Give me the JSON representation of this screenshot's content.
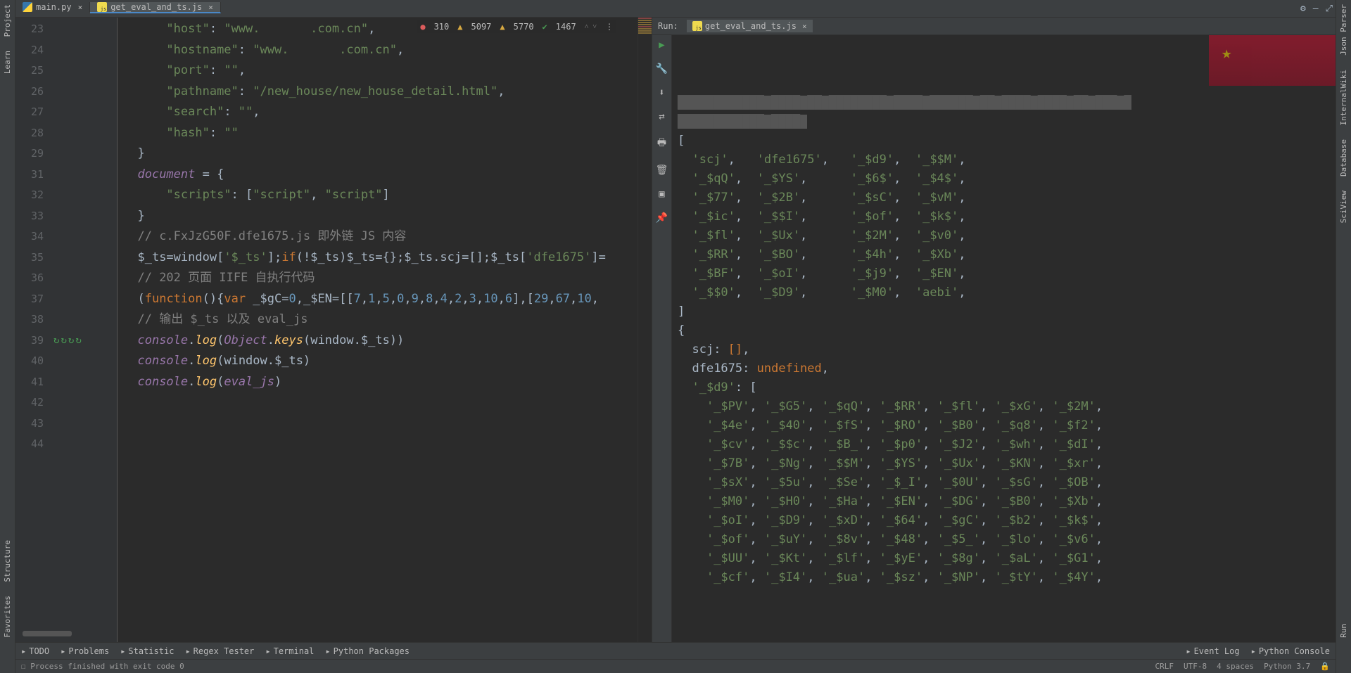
{
  "tabs": [
    {
      "icon": "py",
      "label": "main.py",
      "active": false
    },
    {
      "icon": "js",
      "label": "get_eval_and_ts.js",
      "active": true
    }
  ],
  "left_rail": [
    "Project",
    "Learn",
    "Structure",
    "Favorites"
  ],
  "right_rail": [
    "Json Parser",
    "InternalWiki",
    "Database",
    "SciView",
    "Run"
  ],
  "analysis": {
    "errors": "310",
    "warn1": "5097",
    "warn2": "5770",
    "ok": "1467"
  },
  "gutter_numbers": [
    "23",
    "24",
    "25",
    "26",
    "27",
    "28",
    "29",
    "",
    "31",
    "32",
    "33",
    "34",
    "35",
    "36",
    "37",
    "38",
    "39",
    "40",
    "41",
    "42",
    "43",
    "44"
  ],
  "code_lines": [
    {
      "indent": 6,
      "tokens": [
        {
          "t": "str",
          "v": "\"host\""
        },
        {
          "t": "pl",
          "v": ": "
        },
        {
          "t": "str",
          "v": "\"www."
        },
        {
          "t": "redact",
          "v": "       "
        },
        {
          "t": "str",
          "v": ".com.cn\""
        },
        {
          "t": "pl",
          "v": ","
        }
      ]
    },
    {
      "indent": 6,
      "tokens": [
        {
          "t": "str",
          "v": "\"hostname\""
        },
        {
          "t": "pl",
          "v": ": "
        },
        {
          "t": "str",
          "v": "\"www."
        },
        {
          "t": "redact",
          "v": "       "
        },
        {
          "t": "str",
          "v": ".com.cn\""
        },
        {
          "t": "pl",
          "v": ","
        }
      ]
    },
    {
      "indent": 6,
      "tokens": [
        {
          "t": "str",
          "v": "\"port\""
        },
        {
          "t": "pl",
          "v": ": "
        },
        {
          "t": "str",
          "v": "\"\""
        },
        {
          "t": "pl",
          "v": ","
        }
      ]
    },
    {
      "indent": 6,
      "tokens": [
        {
          "t": "str",
          "v": "\"pathname\""
        },
        {
          "t": "pl",
          "v": ": "
        },
        {
          "t": "str",
          "v": "\"/new_house/new_house_detail.html\""
        },
        {
          "t": "pl",
          "v": ","
        }
      ]
    },
    {
      "indent": 6,
      "tokens": [
        {
          "t": "str",
          "v": "\"search\""
        },
        {
          "t": "pl",
          "v": ": "
        },
        {
          "t": "str",
          "v": "\"\""
        },
        {
          "t": "pl",
          "v": ","
        }
      ]
    },
    {
      "indent": 6,
      "tokens": [
        {
          "t": "str",
          "v": "\"hash\""
        },
        {
          "t": "pl",
          "v": ": "
        },
        {
          "t": "str",
          "v": "\"\""
        }
      ]
    },
    {
      "indent": 2,
      "tokens": [
        {
          "t": "pl",
          "v": "}"
        }
      ]
    },
    {
      "indent": 0,
      "tokens": []
    },
    {
      "indent": 2,
      "tokens": [
        {
          "t": "id",
          "v": "document"
        },
        {
          "t": "pl",
          "v": " = {"
        }
      ]
    },
    {
      "indent": 6,
      "tokens": [
        {
          "t": "str",
          "v": "\"scripts\""
        },
        {
          "t": "pl",
          "v": ": ["
        },
        {
          "t": "str",
          "v": "\"script\""
        },
        {
          "t": "pl",
          "v": ", "
        },
        {
          "t": "str",
          "v": "\"script\""
        },
        {
          "t": "pl",
          "v": "]"
        }
      ]
    },
    {
      "indent": 2,
      "tokens": [
        {
          "t": "pl",
          "v": "}"
        }
      ]
    },
    {
      "indent": 0,
      "tokens": []
    },
    {
      "indent": 2,
      "tokens": [
        {
          "t": "cm",
          "v": "// c.FxJzG50F.dfe1675.js 即外链 JS 内容"
        }
      ]
    },
    {
      "indent": 2,
      "tokens": [
        {
          "t": "pl",
          "v": "$_ts=window["
        },
        {
          "t": "str",
          "v": "'$_ts'"
        },
        {
          "t": "pl",
          "v": "];"
        },
        {
          "t": "kw",
          "v": "if"
        },
        {
          "t": "pl",
          "v": "(!$_ts)$_ts={};$_ts.scj=[];$_ts["
        },
        {
          "t": "str",
          "v": "'dfe1675'"
        },
        {
          "t": "pl",
          "v": "]="
        }
      ]
    },
    {
      "indent": 2,
      "tokens": [
        {
          "t": "cm",
          "v": "// 202 页面 IIFE 自执行代码"
        }
      ]
    },
    {
      "indent": 2,
      "tokens": [
        {
          "t": "pl",
          "v": "("
        },
        {
          "t": "kw",
          "v": "function"
        },
        {
          "t": "pl",
          "v": "(){"
        },
        {
          "t": "kw",
          "v": "var"
        },
        {
          "t": "pl",
          "v": " _$gC="
        },
        {
          "t": "num",
          "v": "0"
        },
        {
          "t": "pl",
          "v": ",_$EN=[["
        },
        {
          "t": "num",
          "v": "7"
        },
        {
          "t": "pl",
          "v": ","
        },
        {
          "t": "num",
          "v": "1"
        },
        {
          "t": "pl",
          "v": ","
        },
        {
          "t": "num",
          "v": "5"
        },
        {
          "t": "pl",
          "v": ","
        },
        {
          "t": "num",
          "v": "0"
        },
        {
          "t": "pl",
          "v": ","
        },
        {
          "t": "num",
          "v": "9"
        },
        {
          "t": "pl",
          "v": ","
        },
        {
          "t": "num",
          "v": "8"
        },
        {
          "t": "pl",
          "v": ","
        },
        {
          "t": "num",
          "v": "4"
        },
        {
          "t": "pl",
          "v": ","
        },
        {
          "t": "num",
          "v": "2"
        },
        {
          "t": "pl",
          "v": ","
        },
        {
          "t": "num",
          "v": "3"
        },
        {
          "t": "pl",
          "v": ","
        },
        {
          "t": "num",
          "v": "10"
        },
        {
          "t": "pl",
          "v": ","
        },
        {
          "t": "num",
          "v": "6"
        },
        {
          "t": "pl",
          "v": "],["
        },
        {
          "t": "num",
          "v": "29"
        },
        {
          "t": "pl",
          "v": ","
        },
        {
          "t": "num",
          "v": "67"
        },
        {
          "t": "pl",
          "v": ","
        },
        {
          "t": "num",
          "v": "10"
        },
        {
          "t": "pl",
          "v": ","
        }
      ]
    },
    {
      "indent": 0,
      "tokens": []
    },
    {
      "indent": 2,
      "tokens": [
        {
          "t": "cm",
          "v": "// 输出 $_ts 以及 eval_js"
        }
      ]
    },
    {
      "indent": 2,
      "tokens": [
        {
          "t": "id",
          "v": "console"
        },
        {
          "t": "pl",
          "v": "."
        },
        {
          "t": "fn",
          "v": "log"
        },
        {
          "t": "pl",
          "v": "("
        },
        {
          "t": "id",
          "v": "Object"
        },
        {
          "t": "pl",
          "v": "."
        },
        {
          "t": "fn",
          "v": "keys"
        },
        {
          "t": "pl",
          "v": "(window.$_ts))"
        }
      ]
    },
    {
      "indent": 2,
      "tokens": [
        {
          "t": "id",
          "v": "console"
        },
        {
          "t": "pl",
          "v": "."
        },
        {
          "t": "fn",
          "v": "log"
        },
        {
          "t": "pl",
          "v": "(window.$_ts)"
        }
      ]
    },
    {
      "indent": 2,
      "tokens": [
        {
          "t": "id",
          "v": "console"
        },
        {
          "t": "pl",
          "v": "."
        },
        {
          "t": "fn",
          "v": "log"
        },
        {
          "t": "pl",
          "v": "("
        },
        {
          "t": "id",
          "v": "eval_js"
        },
        {
          "t": "pl",
          "v": ")"
        }
      ]
    },
    {
      "indent": 0,
      "tokens": []
    }
  ],
  "run": {
    "label": "Run:",
    "tab_label": "get_eval_and_ts.js",
    "output_rows": [
      {
        "type": "br",
        "v": "["
      },
      {
        "type": "arr",
        "v": [
          "'scj'",
          "'dfe1675'",
          "'_$d9'",
          "'_$$M'"
        ]
      },
      {
        "type": "arr",
        "v": [
          "'_$qQ'",
          "'_$YS'",
          "'_$6$'",
          "'_$4$'"
        ]
      },
      {
        "type": "arr",
        "v": [
          "'_$77'",
          "'_$2B'",
          "'_$sC'",
          "'_$vM'"
        ]
      },
      {
        "type": "arr",
        "v": [
          "'_$ic'",
          "'_$$I'",
          "'_$of'",
          "'_$k$'"
        ]
      },
      {
        "type": "arr",
        "v": [
          "'_$fl'",
          "'_$Ux'",
          "'_$2M'",
          "'_$v0'"
        ]
      },
      {
        "type": "arr",
        "v": [
          "'_$RR'",
          "'_$BO'",
          "'_$4h'",
          "'_$Xb'"
        ]
      },
      {
        "type": "arr",
        "v": [
          "'_$BF'",
          "'_$oI'",
          "'_$j9'",
          "'_$EN'"
        ]
      },
      {
        "type": "arr",
        "v": [
          "'_$$0'",
          "'_$D9'",
          "'_$M0'",
          "'aebi'"
        ]
      },
      {
        "type": "br",
        "v": "]"
      },
      {
        "type": "br",
        "v": "{"
      },
      {
        "type": "kv",
        "k": "scj",
        "v": "[]"
      },
      {
        "type": "kv",
        "k": "dfe1675",
        "v": "undefined"
      },
      {
        "type": "kvs",
        "k": "'_$d9'",
        "v": "["
      },
      {
        "type": "arr7",
        "v": [
          "'_$PV'",
          "'_$G5'",
          "'_$qQ'",
          "'_$RR'",
          "'_$fl'",
          "'_$xG'",
          "'_$2M'"
        ]
      },
      {
        "type": "arr7",
        "v": [
          "'_$4e'",
          "'_$40'",
          "'_$fS'",
          "'_$RO'",
          "'_$B0'",
          "'_$q8'",
          "'_$f2'"
        ]
      },
      {
        "type": "arr7",
        "v": [
          "'_$cv'",
          "'_$$c'",
          "'_$B_'",
          "'_$p0'",
          "'_$J2'",
          "'_$wh'",
          "'_$dI'"
        ]
      },
      {
        "type": "arr7",
        "v": [
          "'_$7B'",
          "'_$Ng'",
          "'_$$M'",
          "'_$YS'",
          "'_$Ux'",
          "'_$KN'",
          "'_$xr'"
        ]
      },
      {
        "type": "arr7",
        "v": [
          "'_$sX'",
          "'_$5u'",
          "'_$Se'",
          "'_$_I'",
          "'_$0U'",
          "'_$sG'",
          "'_$OB'"
        ]
      },
      {
        "type": "arr7",
        "v": [
          "'_$M0'",
          "'_$H0'",
          "'_$Ha'",
          "'_$EN'",
          "'_$DG'",
          "'_$B0'",
          "'_$Xb'"
        ]
      },
      {
        "type": "arr7",
        "v": [
          "'_$oI'",
          "'_$D9'",
          "'_$xD'",
          "'_$64'",
          "'_$gC'",
          "'_$b2'",
          "'_$k$'"
        ]
      },
      {
        "type": "arr7",
        "v": [
          "'_$of'",
          "'_$uY'",
          "'_$8v'",
          "'_$48'",
          "'_$5_'",
          "'_$lo'",
          "'_$v6'"
        ]
      },
      {
        "type": "arr7",
        "v": [
          "'_$UU'",
          "'_$Kt'",
          "'_$lf'",
          "'_$yE'",
          "'_$8g'",
          "'_$aL'",
          "'_$G1'"
        ]
      },
      {
        "type": "arr7",
        "v": [
          "'_$cf'",
          "'_$I4'",
          "'_$ua'",
          "'_$sz'",
          "'_$NP'",
          "'_$tY'",
          "'_$4Y'"
        ]
      }
    ]
  },
  "bottom_items_left": [
    "TODO",
    "Problems",
    "Statistic",
    "Regex Tester",
    "Terminal",
    "Python Packages"
  ],
  "bottom_items_right": [
    "Event Log",
    "Python Console"
  ],
  "status": {
    "msg": "Process finished with exit code 0",
    "enc1": "CRLF",
    "enc2": "UTF-8",
    "indent": "4 spaces",
    "py": "Python 3.7"
  }
}
